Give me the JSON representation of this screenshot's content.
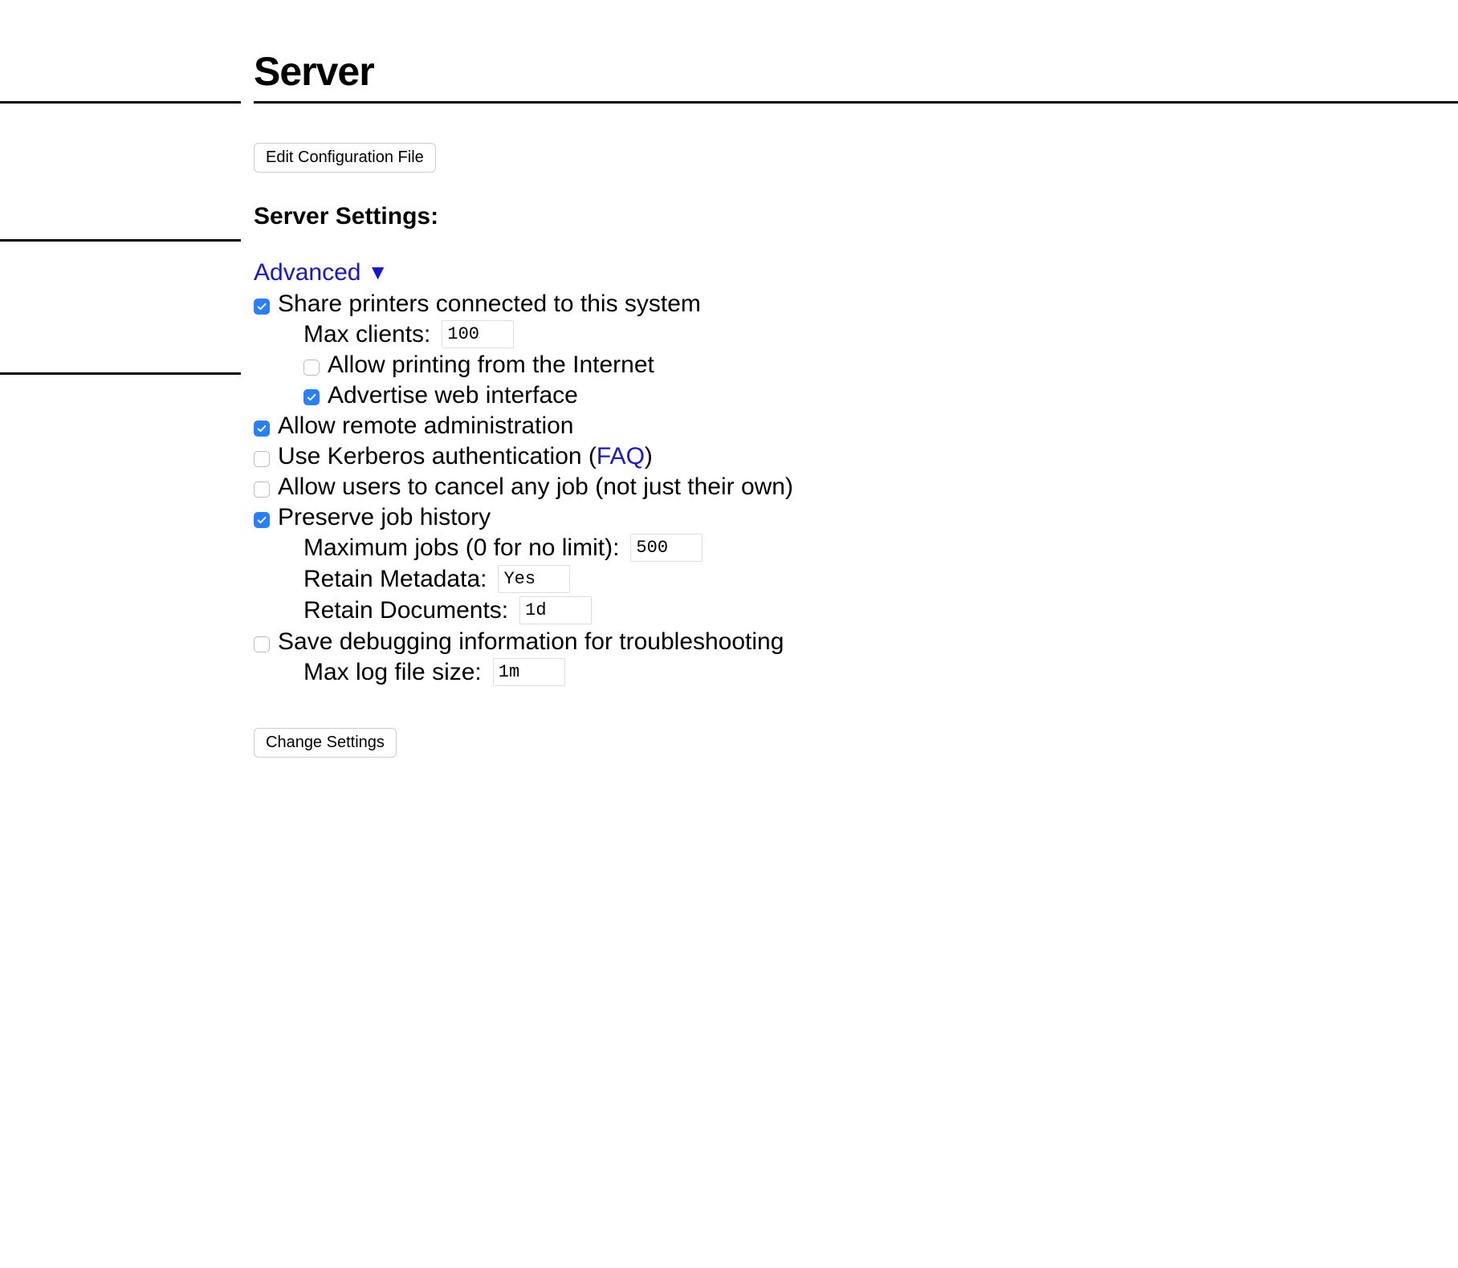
{
  "header": {
    "title": "Server"
  },
  "buttons": {
    "edit_config": "Edit Configuration File",
    "change_settings": "Change Settings"
  },
  "section_title": "Server Settings:",
  "advanced": {
    "label": "Advanced",
    "triangle": "▼"
  },
  "settings": {
    "share_printers": {
      "checked": true,
      "label": "Share printers connected to this system",
      "max_clients_label": "Max clients:",
      "max_clients_value": "100",
      "allow_internet": {
        "checked": false,
        "label": "Allow printing from the Internet"
      },
      "advertise_web": {
        "checked": true,
        "label": "Advertise web interface"
      }
    },
    "allow_remote_admin": {
      "checked": true,
      "label": "Allow remote administration"
    },
    "kerberos": {
      "checked": false,
      "label_pre": "Use Kerberos authentication (",
      "faq": "FAQ",
      "label_post": ")"
    },
    "cancel_any": {
      "checked": false,
      "label": "Allow users to cancel any job (not just their own)"
    },
    "preserve_history": {
      "checked": true,
      "label": "Preserve job history",
      "max_jobs_label": "Maximum jobs (0 for no limit):",
      "max_jobs_value": "500",
      "retain_metadata_label": "Retain Metadata:",
      "retain_metadata_value": "Yes",
      "retain_documents_label": "Retain Documents:",
      "retain_documents_value": "1d"
    },
    "debug": {
      "checked": false,
      "label": "Save debugging information for troubleshooting",
      "max_log_label": "Max log file size:",
      "max_log_value": "1m"
    }
  }
}
